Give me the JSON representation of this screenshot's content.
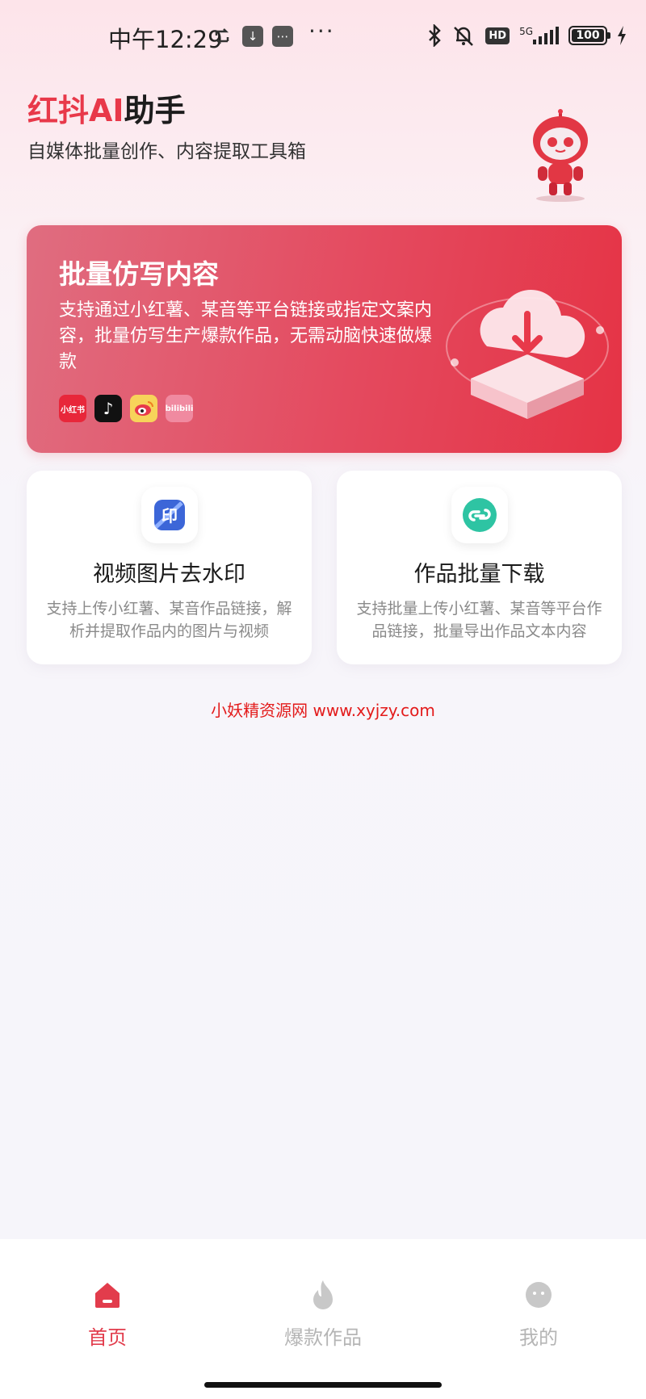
{
  "status_bar": {
    "time": "中午12:29",
    "battery": "100",
    "network": "5G",
    "hd": "HD"
  },
  "header": {
    "title_accent": "红抖AI",
    "title_rest": "助手",
    "subtitle": "自媒体批量创作、内容提取工具箱"
  },
  "banner": {
    "title": "批量仿写内容",
    "description": "支持通过小红薯、某音等平台链接或指定文案内容，批量仿写生产爆款作品，无需动脑快速做爆款",
    "platforms": [
      "小红书",
      "bilibili"
    ]
  },
  "cards": [
    {
      "title": "视频图片去水印",
      "description": "支持上传小红薯、某音作品链接，解析并提取作品内的图片与视频",
      "icon_text": "印"
    },
    {
      "title": "作品批量下载",
      "description": "支持批量上传小红薯、某音等平台作品链接，批量导出作品文本内容"
    }
  ],
  "watermark": "小妖精资源网 www.xyjzy.com",
  "tabbar": {
    "home": "首页",
    "hot": "爆款作品",
    "me": "我的"
  },
  "colors": {
    "accent": "#e8394a",
    "banner_start": "#e06d80",
    "banner_end": "#e53345",
    "inactive_tab": "#b5b5b5"
  }
}
